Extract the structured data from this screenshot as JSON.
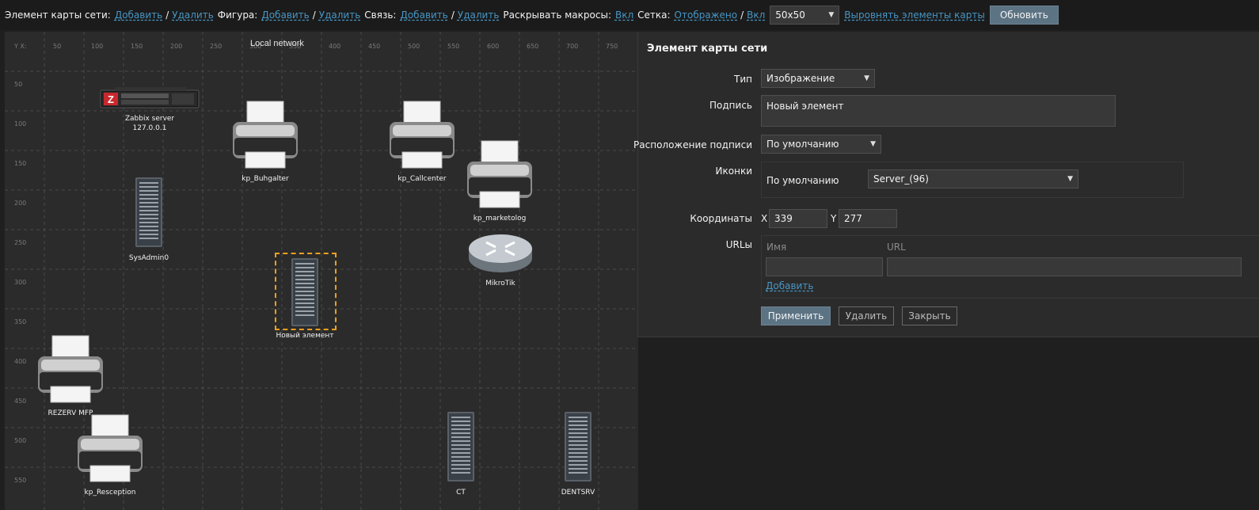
{
  "toolbar": {
    "map_element_label": "Элемент карты сети:",
    "map_element_add": "Добавить",
    "map_element_remove": "Удалить",
    "shape_label": "Фигура:",
    "shape_add": "Добавить",
    "shape_remove": "Удалить",
    "link_label": "Связь:",
    "link_add": "Добавить",
    "link_remove": "Удалить",
    "expand_macros_label": "Раскрывать макросы:",
    "expand_macros_value": "Вкл",
    "grid_label": "Сетка:",
    "grid_shown": "Отображено",
    "grid_on": "Вкл",
    "grid_size": "50x50",
    "align_label": "Выровнять элементы карты",
    "update_button": "Обновить"
  },
  "map": {
    "title": "Local network",
    "y_axis_header": "Y X:",
    "x_ticks": [
      "50",
      "100",
      "150",
      "200",
      "250",
      "300",
      "350",
      "400",
      "450",
      "500",
      "550",
      "600",
      "650",
      "700",
      "750"
    ],
    "y_ticks": [
      "50",
      "100",
      "150",
      "200",
      "250",
      "300",
      "350",
      "400",
      "450",
      "500",
      "550"
    ],
    "elements": [
      {
        "label": "Zabbix server",
        "sublabel": "127.0.0.1",
        "icon": "rack-server-icon"
      },
      {
        "label": "kp_Buhgalter",
        "icon": "printer-icon"
      },
      {
        "label": "kp_Callcenter",
        "icon": "printer-icon"
      },
      {
        "label": "kp_marketolog",
        "icon": "printer-icon"
      },
      {
        "label": "SysAdmin0",
        "icon": "tower-server-icon"
      },
      {
        "label": "MikroTik",
        "icon": "router-icon"
      },
      {
        "label": "Новый элемент",
        "icon": "tower-server-icon"
      },
      {
        "label": "REZERV MFP",
        "icon": "printer-icon"
      },
      {
        "label": "kp_Resception",
        "icon": "printer-icon"
      },
      {
        "label": "CT",
        "icon": "tower-server-icon"
      },
      {
        "label": "DENTSRV",
        "icon": "tower-server-icon"
      }
    ]
  },
  "panel": {
    "title": "Элемент карты сети",
    "type_label": "Тип",
    "type_value": "Изображение",
    "caption_label": "Подпись",
    "caption_value": "Новый элемент",
    "label_location_label": "Расположение подписи",
    "label_location_value": "По умолчанию",
    "icons_label": "Иконки",
    "icons_default_label": "По умолчанию",
    "icons_default_value": "Server_(96)",
    "coords_label": "Координаты",
    "coord_x_label": "X",
    "coord_x_value": "339",
    "coord_y_label": "Y",
    "coord_y_value": "277",
    "urls_label": "URLы",
    "url_name_header": "Имя",
    "url_header": "URL",
    "url_add": "Добавить",
    "apply_button": "Применить",
    "delete_button": "Удалить",
    "close_button": "Закрыть"
  },
  "colors": {
    "link": "#4796c4",
    "selection": "#f0a020",
    "primary_button": "#5c7384"
  }
}
